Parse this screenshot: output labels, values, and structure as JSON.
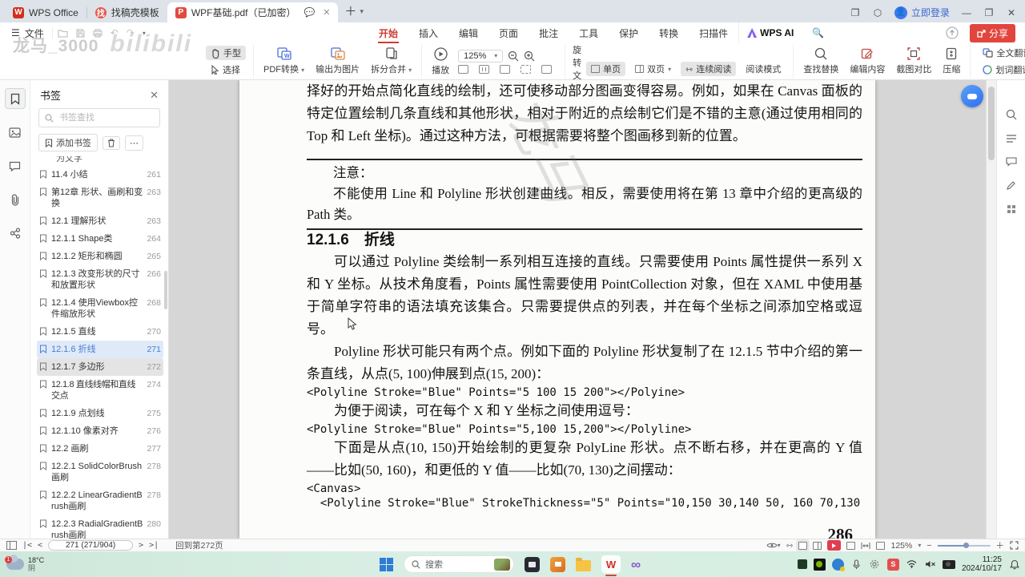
{
  "colors": {
    "accent_red": "#e2453d",
    "menu_active_red": "#cf3b33",
    "selected_blue_text": "#4a7ed0",
    "selected_blue_bg": "#dfe9f8",
    "taskbar_green": "#d9efe5",
    "doc_bg_gray": "#d6d6d6"
  },
  "tabbar": {
    "tabs": [
      {
        "label": "WPS Office"
      },
      {
        "label": "找稿壳模板"
      },
      {
        "label": "WPF基础.pdf（已加密）"
      }
    ],
    "login_label": "立即登录"
  },
  "menubar": {
    "file_label": "文件",
    "items": [
      "开始",
      "插入",
      "编辑",
      "页面",
      "批注",
      "工具",
      "保护",
      "转换",
      "扫描件"
    ],
    "active_item": "开始",
    "ai_label": "WPS AI",
    "share_label": "分享"
  },
  "toolbar": {
    "hand": "手型",
    "select": "选择",
    "pdf_convert": "PDF转换",
    "export_image": "输出为图片",
    "split_merge": "拆分合并",
    "play": "播放",
    "zoom_value": "125%",
    "rotate_doc": "旋转文档",
    "page_input": "271 (271/904)",
    "single_page": "单页",
    "double_page": "双页",
    "continuous": "连续阅读",
    "read_mode": "阅读模式",
    "find_replace": "查找替换",
    "edit_content": "编辑内容",
    "screenshot_compare": "截图对比",
    "compress": "压缩",
    "full_translate": "全文翻译",
    "word_translate": "划词翻译"
  },
  "sidebar": {
    "title": "书签",
    "search_placeholder": "书签查找",
    "add_label": "添加书签",
    "partial_item": "为文字",
    "items": [
      {
        "label": "11.4 小结",
        "page": "261"
      },
      {
        "label": "第12章 形状、画刷和变换",
        "page": "263"
      },
      {
        "label": "12.1 理解形状",
        "page": "263"
      },
      {
        "label": "12.1.1 Shape类",
        "page": "264"
      },
      {
        "label": "12.1.2 矩形和椭圆",
        "page": "265"
      },
      {
        "label": "12.1.3 改变形状的尺寸和放置形状",
        "page": "266"
      },
      {
        "label": "12.1.4 使用Viewbox控件缩放形状",
        "page": "268"
      },
      {
        "label": "12.1.5 直线",
        "page": "270"
      },
      {
        "label": "12.1.6 折线",
        "page": "271"
      },
      {
        "label": "12.1.7 多边形",
        "page": "272"
      },
      {
        "label": "12.1.8 直线线帽和直线交点",
        "page": "274"
      },
      {
        "label": "12.1.9 点划线",
        "page": "275"
      },
      {
        "label": "12.1.10 像素对齐",
        "page": "276"
      },
      {
        "label": "12.2 画刷",
        "page": "277"
      },
      {
        "label": "12.2.1 SolidColorBrush画刷",
        "page": "278"
      },
      {
        "label": "12.2.2 LinearGradientBrush画刷",
        "page": "278"
      },
      {
        "label": "12.2.3 RadialGradientBrush画刷",
        "page": "280"
      },
      {
        "label": "12.2.4 ImageBrush画刷",
        "page": "282"
      }
    ]
  },
  "document": {
    "para1": "择好的开始点简化直线的绘制，还可使移动部分图画变得容易。例如，如果在 Canvas 面板的特定位置绘制几条直线和其他形状，相对于附近的点绘制它们是不错的主意(通过使用相同的 Top 和 Left 坐标)。通过这种方法，可根据需要将整个图画移到新的位置。",
    "note_title": "注意：",
    "note_body": "不能使用 Line 和 Polyline 形状创建曲线。相反，需要使用将在第 13 章中介绍的更高级的 Path 类。",
    "heading": "12.1.6　折线",
    "para2": "可以通过 Polyline 类绘制一系列相互连接的直线。只需要使用 Points 属性提供一系列 X 和 Y 坐标。从技术角度看，Points 属性需要使用 PointCollection 对象，但在 XAML 中使用基于简单字符串的语法填充该集合。只需要提供点的列表，并在每个坐标之间添加空格或逗号。",
    "para3": "Polyline 形状可能只有两个点。例如下面的 Polyline 形状复制了在 12.1.5 节中介绍的第一条直线，从点(5, 100)伸展到点(15, 200)：",
    "code1": "<Polyline Stroke=\"Blue\" Points=\"5 100 15 200\"></Polyine>",
    "para4": "为便于阅读，可在每个 X 和 Y 坐标之间使用逗号：",
    "code2": "<Polyline Stroke=\"Blue\" Points=\"5,100 15,200\"></Polyline>",
    "para5": "下面是从点(10, 150)开始绘制的更复杂 PolyLine 形状。点不断右移，并在更高的 Y 值——比如(50, 160)，和更低的 Y 值——比如(70, 130)之间摆动：",
    "code3_line1": "<Canvas>",
    "code3_line2": "  <Polyline Stroke=\"Blue\" StrokeThickness=\"5\" Points=\"10,150 30,140 50, 160 70,130",
    "page_number": "286",
    "watermark": "龙马",
    "ghost_watermark_1": "龙马_3000",
    "ghost_watermark_2": "bilibili"
  },
  "statusbar": {
    "page_input": "271 (271/904)",
    "back_label": "回到第272页",
    "zoom_value": "125%"
  },
  "taskbar": {
    "temperature": "18°C",
    "weather": "阴",
    "search_placeholder": "搜索",
    "time": "11:25",
    "date": "2024/10/17"
  }
}
